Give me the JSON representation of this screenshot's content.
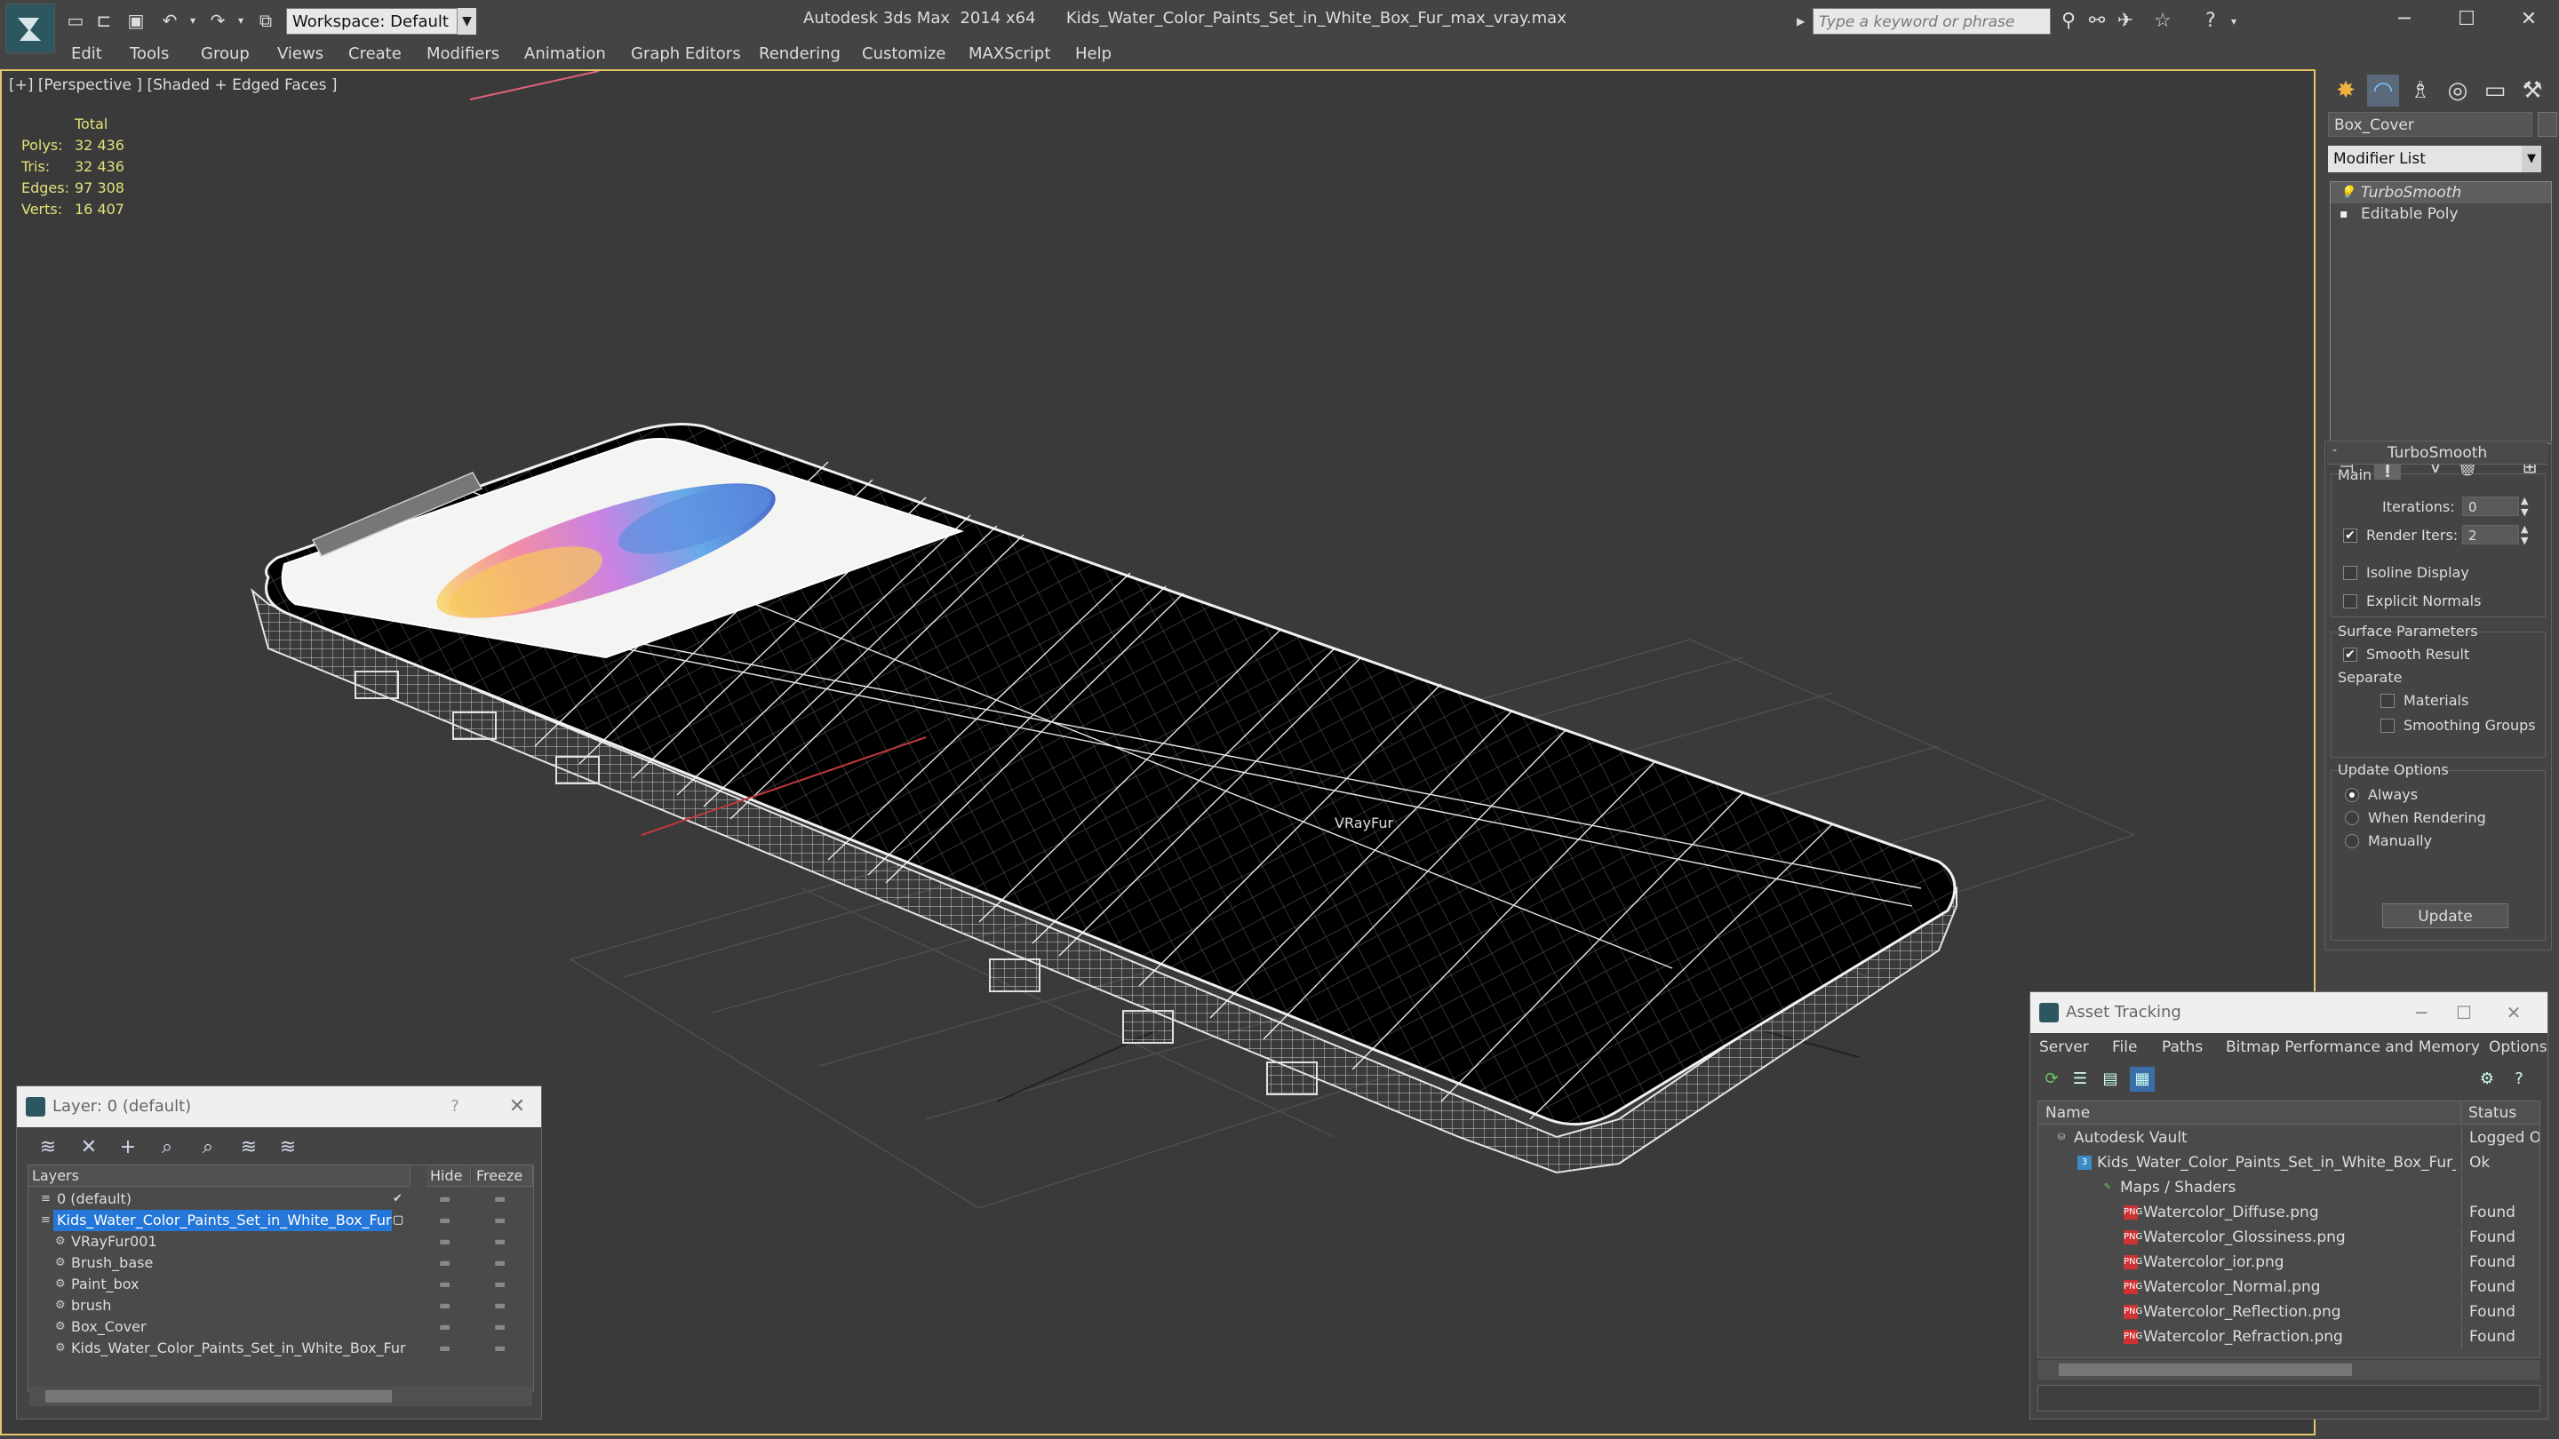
{
  "titlebar": {
    "workspace": "Workspace: Default",
    "app_title": "Autodesk 3ds Max  2014 x64      Kids_Water_Color_Paints_Set_in_White_Box_Fur_max_vray.max",
    "search_placeholder": "Type a keyword or phrase"
  },
  "menu": [
    "Edit",
    "Tools",
    "Group",
    "Views",
    "Create",
    "Modifiers",
    "Animation",
    "Graph Editors",
    "Rendering",
    "Customize",
    "MAXScript",
    "Help"
  ],
  "viewport": {
    "label": "[+] [Perspective ] [Shaded + Edged Faces ]",
    "stats_header": "Total",
    "stats": [
      {
        "name": "Polys:",
        "value": "32 436"
      },
      {
        "name": "Tris:",
        "value": "32 436"
      },
      {
        "name": "Edges:",
        "value": "97 308"
      },
      {
        "name": "Verts:",
        "value": "16 407"
      }
    ],
    "object_label": "VRayFur"
  },
  "command_panel": {
    "object_name": "Box_Cover",
    "modifier_list": "Modifier List",
    "stack": [
      "TurboSmooth",
      "Editable Poly"
    ],
    "rollout_title": "TurboSmooth",
    "main_label": "Main",
    "iterations_label": "Iterations:",
    "iterations_value": "0",
    "render_iters_label": "Render Iters:",
    "render_iters_value": "2",
    "isoline_label": "Isoline Display",
    "explicit_normals_label": "Explicit Normals",
    "surface_params_label": "Surface Parameters",
    "smooth_result_label": "Smooth Result",
    "separate_label": "Separate",
    "materials_label": "Materials",
    "smoothing_groups_label": "Smoothing Groups",
    "update_options_label": "Update Options",
    "always_label": "Always",
    "when_rendering_label": "When Rendering",
    "manually_label": "Manually",
    "update_button": "Update"
  },
  "layer_window": {
    "title": "Layer: 0 (default)",
    "help": "?",
    "columns": [
      "Layers",
      "Hide",
      "Freeze"
    ],
    "rows": [
      {
        "name": "0 (default)",
        "indent": 0,
        "selected": false,
        "check": "✔"
      },
      {
        "name": "Kids_Water_Color_Paints_Set_in_White_Box_Fur",
        "indent": 0,
        "selected": true,
        "check": "▢"
      },
      {
        "name": "VRayFur001",
        "indent": 1,
        "selected": false,
        "check": ""
      },
      {
        "name": "Brush_base",
        "indent": 1,
        "selected": false,
        "check": ""
      },
      {
        "name": "Paint_box",
        "indent": 1,
        "selected": false,
        "check": ""
      },
      {
        "name": "brush",
        "indent": 1,
        "selected": false,
        "check": ""
      },
      {
        "name": "Box_Cover",
        "indent": 1,
        "selected": false,
        "check": ""
      },
      {
        "name": "Kids_Water_Color_Paints_Set_in_White_Box_Fur",
        "indent": 1,
        "selected": false,
        "check": ""
      }
    ]
  },
  "asset_window": {
    "title": "Asset Tracking",
    "menu": [
      "Server",
      "File",
      "Paths",
      "Bitmap Performance and Memory",
      "Options"
    ],
    "columns": [
      "Name",
      "Status"
    ],
    "rows": [
      {
        "name": "Autodesk Vault",
        "status": "Logged O",
        "indent": 0,
        "icon": "vault"
      },
      {
        "name": "Kids_Water_Color_Paints_Set_in_White_Box_Fur_...",
        "status": "Ok",
        "indent": 1,
        "icon": "max"
      },
      {
        "name": "Maps / Shaders",
        "status": "",
        "indent": 2,
        "icon": "maps"
      },
      {
        "name": "Watercolor_Diffuse.png",
        "status": "Found",
        "indent": 3,
        "icon": "png"
      },
      {
        "name": "Watercolor_Glossiness.png",
        "status": "Found",
        "indent": 3,
        "icon": "png"
      },
      {
        "name": "Watercolor_ior.png",
        "status": "Found",
        "indent": 3,
        "icon": "png"
      },
      {
        "name": "Watercolor_Normal.png",
        "status": "Found",
        "indent": 3,
        "icon": "png"
      },
      {
        "name": "Watercolor_Reflection.png",
        "status": "Found",
        "indent": 3,
        "icon": "png"
      },
      {
        "name": "Watercolor_Refraction.png",
        "status": "Found",
        "indent": 3,
        "icon": "png"
      }
    ]
  }
}
